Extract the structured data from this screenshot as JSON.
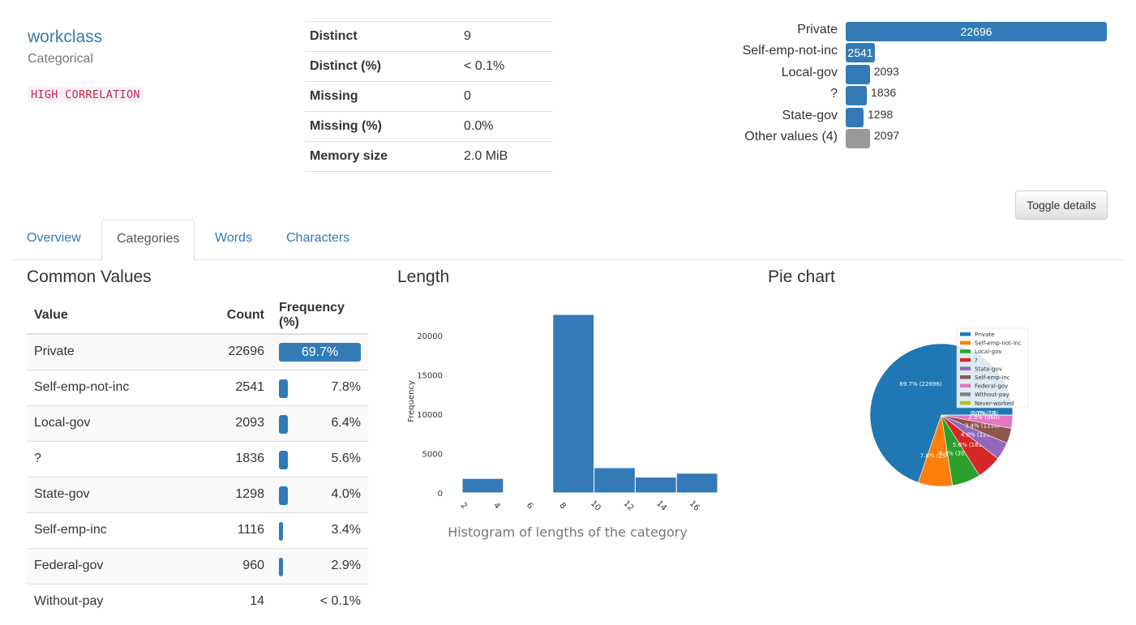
{
  "variable": {
    "name": "workclass",
    "type": "Categorical",
    "badge": "HIGH CORRELATION"
  },
  "stats": [
    {
      "key": "Distinct",
      "value": "9"
    },
    {
      "key": "Distinct (%)",
      "value": "< 0.1%"
    },
    {
      "key": "Missing",
      "value": "0"
    },
    {
      "key": "Missing (%)",
      "value": "0.0%"
    },
    {
      "key": "Memory size",
      "value": "2.0 MiB"
    }
  ],
  "mini_bars": [
    {
      "label": "Private",
      "value": "22696",
      "count": 22696
    },
    {
      "label": "Self-emp-not-inc",
      "value": "2541",
      "count": 2541
    },
    {
      "label": "Local-gov",
      "value": "2093",
      "count": 2093
    },
    {
      "label": "?",
      "value": "1836",
      "count": 1836
    },
    {
      "label": "State-gov",
      "value": "1298",
      "count": 1298
    },
    {
      "label": "Other values (4)",
      "value": "2097",
      "count": 2097
    }
  ],
  "toggle_label": "Toggle details",
  "tabs": [
    "Overview",
    "Categories",
    "Words",
    "Characters"
  ],
  "active_tab": "Categories",
  "sections": {
    "common_values": "Common Values",
    "length": "Length",
    "pie": "Pie chart"
  },
  "common_values": {
    "headers": {
      "value": "Value",
      "count": "Count",
      "freq": "Frequency (%)"
    },
    "rows": [
      {
        "value": "Private",
        "count": "22696",
        "freq": "69.7%",
        "pct": 69.7
      },
      {
        "value": "Self-emp-not-inc",
        "count": "2541",
        "freq": "7.8%",
        "pct": 7.8
      },
      {
        "value": "Local-gov",
        "count": "2093",
        "freq": "6.4%",
        "pct": 6.4
      },
      {
        "value": "?",
        "count": "1836",
        "freq": "5.6%",
        "pct": 5.6
      },
      {
        "value": "State-gov",
        "count": "1298",
        "freq": "4.0%",
        "pct": 4.0
      },
      {
        "value": "Self-emp-inc",
        "count": "1116",
        "freq": "3.4%",
        "pct": 3.4
      },
      {
        "value": "Federal-gov",
        "count": "960",
        "freq": "2.9%",
        "pct": 2.9
      },
      {
        "value": "Without-pay",
        "count": "14",
        "freq": "< 0.1%",
        "pct": 0.04
      }
    ]
  },
  "histogram_caption": "Histogram of lengths of the category",
  "chart_data": [
    {
      "type": "bar",
      "title": "",
      "xlabel": "",
      "ylabel": "Frequency",
      "bins": [
        [
          2,
          4.5
        ],
        [
          7.5,
          10
        ],
        [
          10,
          12.5
        ],
        [
          12.5,
          15
        ],
        [
          15,
          17.5
        ]
      ],
      "values": [
        1836,
        22696,
        3200,
        2000,
        2500
      ],
      "x_ticks": [
        2,
        4,
        6,
        8,
        10,
        12,
        14,
        16
      ],
      "y_ticks": [
        0,
        5000,
        10000,
        15000,
        20000
      ],
      "xlim": [
        2,
        17.5
      ],
      "ylim": [
        0,
        23000
      ]
    },
    {
      "type": "pie",
      "categories": [
        "Private",
        "Self-emp-not-inc",
        "Local-gov",
        "?",
        "State-gov",
        "Self-emp-inc",
        "Federal-gov",
        "Without-pay",
        "Never-worked"
      ],
      "values": [
        22696,
        2541,
        2093,
        1836,
        1298,
        1116,
        960,
        14,
        7
      ],
      "labels": [
        "69.7%  (22696)",
        "7.8%  (2541)",
        "6.4%  (2093)",
        "5.6%  (1836)",
        "4.0%  (1298)",
        "3.4%  (1116)",
        "2.9%  (960)",
        "0.0%  (14)",
        "0.0%  (7)"
      ],
      "colors": [
        "#1f77b4",
        "#ff7f0e",
        "#2ca02c",
        "#d62728",
        "#9467bd",
        "#8c564b",
        "#e377c2",
        "#7f7f7f",
        "#bcbd22"
      ],
      "legend_position": "top-right"
    }
  ]
}
